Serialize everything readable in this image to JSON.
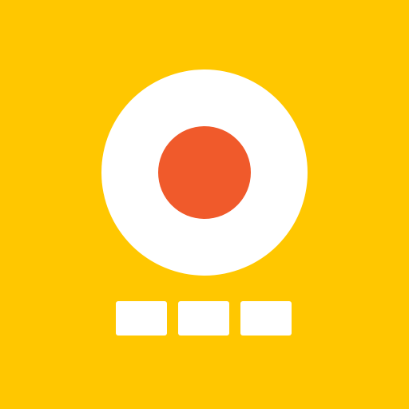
{
  "icon": {
    "name": "record-app-icon",
    "symbol": "record-button-icon",
    "indicator": "three-segment-indicator",
    "colors": {
      "background": "#FFC700",
      "disc": "#FFFFFF",
      "record_dot": "#F05A2B",
      "segments": "#FFFFFF"
    }
  }
}
